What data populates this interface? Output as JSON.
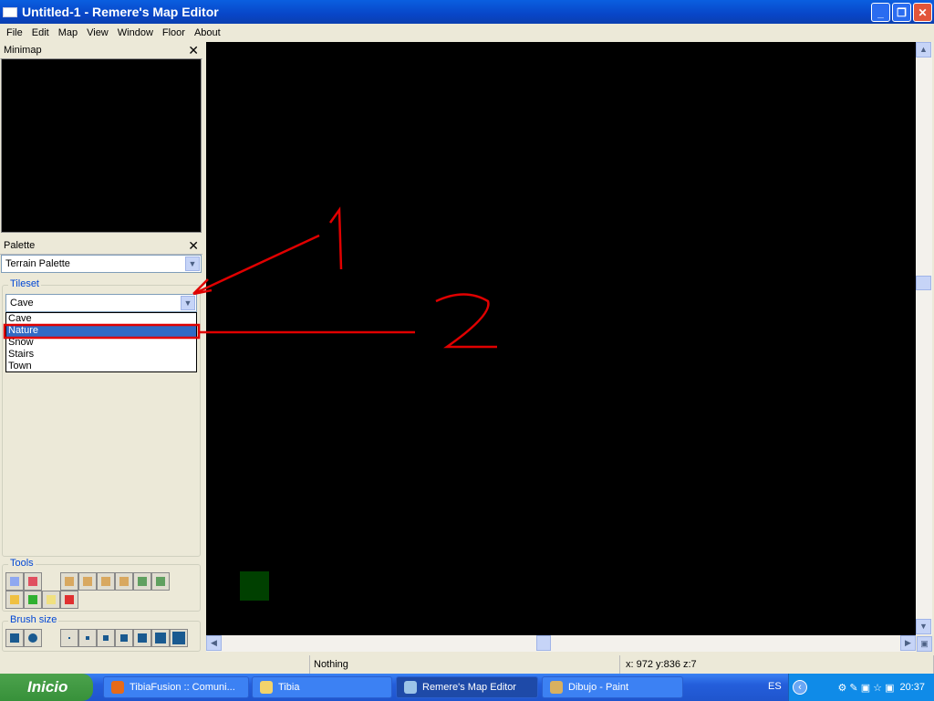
{
  "window": {
    "title": "Untitled-1 - Remere's Map Editor"
  },
  "menu": [
    "File",
    "Edit",
    "Map",
    "View",
    "Window",
    "Floor",
    "About"
  ],
  "minimap": {
    "title": "Minimap"
  },
  "palette": {
    "title": "Palette",
    "selected": "Terrain Palette"
  },
  "tileset": {
    "label": "Tileset",
    "selected": "Cave",
    "options": [
      "Cave",
      "Nature",
      "Snow",
      "Stairs",
      "Town"
    ],
    "highlighted": "Nature"
  },
  "tools": {
    "label": "Tools"
  },
  "brush_size": {
    "label": "Brush size"
  },
  "status": {
    "message": "Nothing",
    "coords": "x: 972 y:836 z:7"
  },
  "taskbar": {
    "start": "Inicio",
    "tasks": [
      "TibiaFusion :: Comuni...",
      "Tibia",
      "Remere's Map Editor",
      "Dibujo - Paint"
    ],
    "language": "ES",
    "clock": "20:37"
  },
  "annotations": {
    "labels": [
      "1",
      "2"
    ],
    "color": "#e00000"
  },
  "colors": {
    "map_bg": "#000000",
    "tile": "#004000",
    "selection": "#316ac5"
  }
}
